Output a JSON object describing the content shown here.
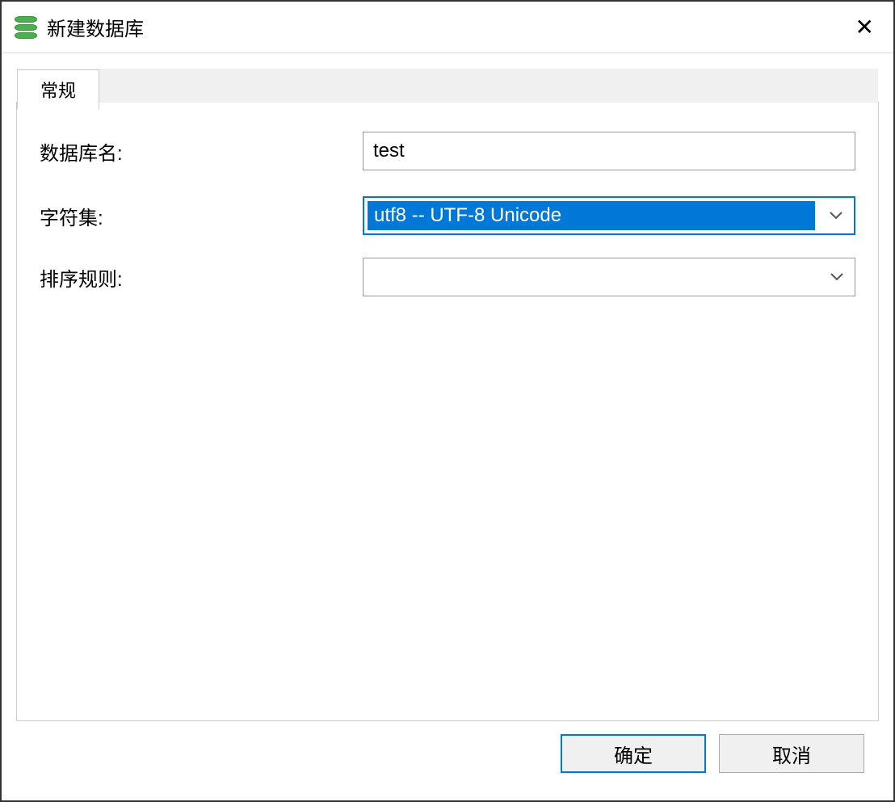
{
  "dialog": {
    "title": "新建数据库",
    "close_symbol": "✕"
  },
  "tabs": {
    "general": "常规"
  },
  "form": {
    "database_name_label": "数据库名:",
    "database_name_value": "test",
    "charset_label": "字符集:",
    "charset_value": "utf8 -- UTF-8 Unicode",
    "collation_label": "排序规则:",
    "collation_value": ""
  },
  "buttons": {
    "ok": "确定",
    "cancel": "取消"
  }
}
